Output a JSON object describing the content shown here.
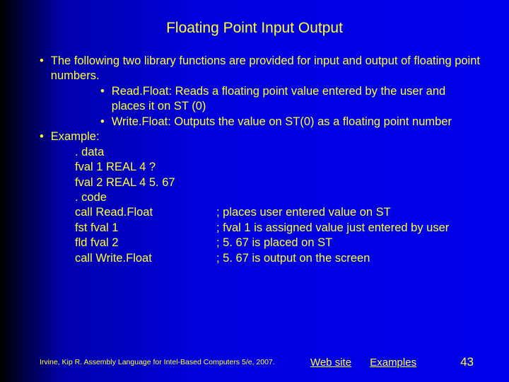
{
  "title": "Floating Point Input Output",
  "b1_intro": "The following two library functions are provided for input and output of floating point numbers.",
  "b1_sub1": "Read.Float: Reads a floating point value entered by the user and places it on ST (0)",
  "b1_sub2": "Write.Float: Outputs the value on ST(0) as a floating point number",
  "b2_label": "Example:",
  "code": {
    "l1": ". data",
    "l2": "fval 1 REAL 4   ?",
    "l3": "fval 2 REAL 4   5. 67",
    "l4": ". code",
    "l5_left": "call Read.Float",
    "l5_right": "; places user entered value on ST",
    "l6_left": "fst fval 1",
    "l6_right": "; fval 1 is assigned value just entered by user",
    "l7_left": "fld fval 2",
    "l7_right": "; 5. 67 is placed on ST",
    "l8_left": "call Write.Float",
    "l8_right": "; 5. 67 is output on the screen"
  },
  "footer": {
    "citation": "Irvine, Kip R. Assembly Language for Intel-Based Computers 5/e, 2007.",
    "link1": "Web site",
    "link2": "Examples",
    "page": "43"
  }
}
